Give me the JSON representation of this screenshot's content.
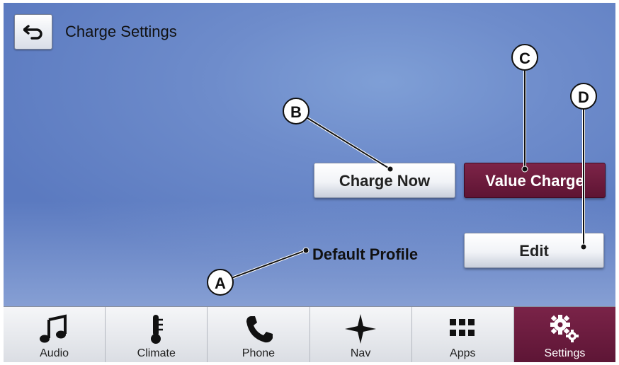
{
  "header": {
    "title": "Charge Settings",
    "back_icon": "back-arrow-icon"
  },
  "buttons": {
    "charge_now": "Charge Now",
    "value_charge": "Value Charge",
    "edit": "Edit"
  },
  "profile": {
    "label": "Default Profile"
  },
  "callouts": {
    "a": "A",
    "b": "B",
    "c": "C",
    "d": "D"
  },
  "nav": [
    {
      "label": "Audio",
      "icon": "music-note-icon"
    },
    {
      "label": "Climate",
      "icon": "thermometer-icon"
    },
    {
      "label": "Phone",
      "icon": "phone-icon"
    },
    {
      "label": "Nav",
      "icon": "compass-star-icon"
    },
    {
      "label": "Apps",
      "icon": "apps-grid-icon"
    },
    {
      "label": "Settings",
      "icon": "gears-icon"
    }
  ],
  "colors": {
    "active": "#6b1a3d",
    "background": "#6e8ccb"
  }
}
